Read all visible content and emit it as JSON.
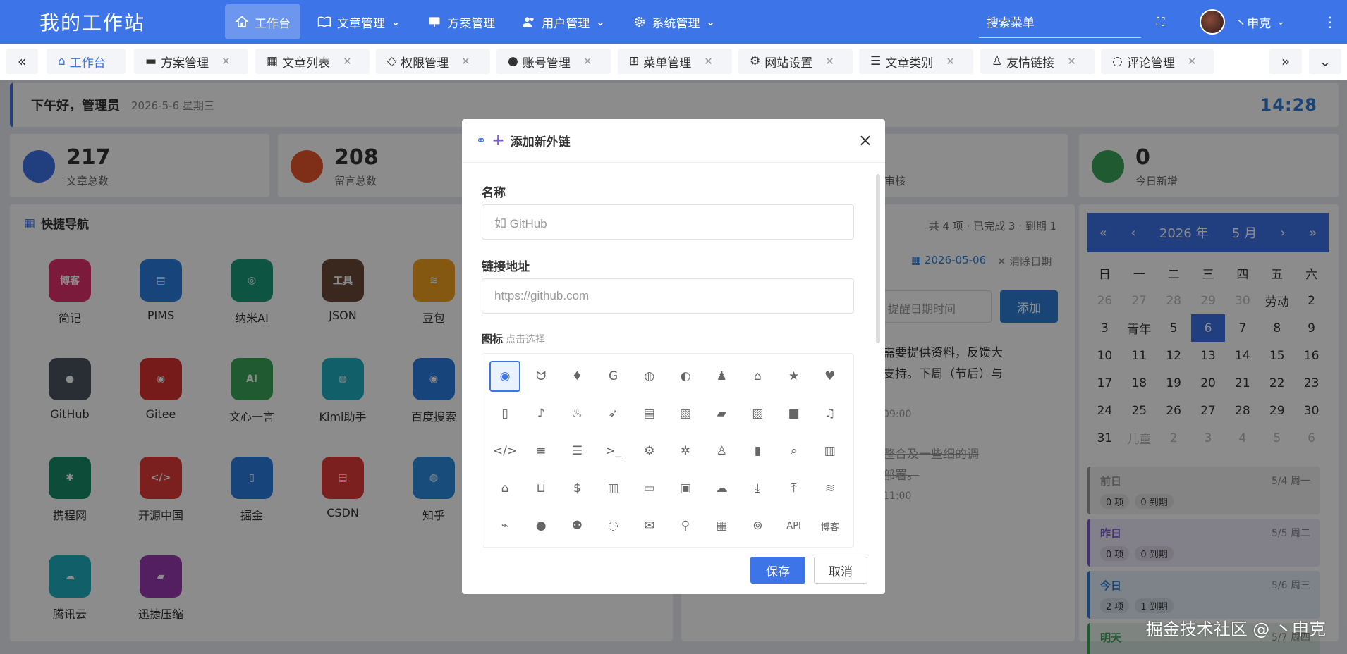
{
  "app": {
    "title": "我的工作站"
  },
  "topnav": {
    "items": [
      {
        "label": "工作台",
        "icon": "home-icon"
      },
      {
        "label": "文章管理",
        "icon": "book-icon"
      },
      {
        "label": "方案管理",
        "icon": "presentation-icon"
      },
      {
        "label": "用户管理",
        "icon": "users-icon"
      },
      {
        "label": "系统管理",
        "icon": "gear-icon"
      }
    ],
    "search_label": "搜索菜单",
    "user": "丶申克"
  },
  "tabs": [
    {
      "label": "工作台"
    },
    {
      "label": "方案管理"
    },
    {
      "label": "文章列表"
    },
    {
      "label": "权限管理"
    },
    {
      "label": "账号管理"
    },
    {
      "label": "菜单管理"
    },
    {
      "label": "网站设置"
    },
    {
      "label": "文章类别"
    },
    {
      "label": "友情链接"
    },
    {
      "label": "评论管理"
    }
  ],
  "greeting": {
    "text": "下午好，管理员",
    "date": "2026-5-6 星期三",
    "time": "14:28"
  },
  "stats": [
    {
      "value": "217",
      "label": "文章总数",
      "color": "#3d74e8"
    },
    {
      "value": "208",
      "label": "留言总数",
      "color": "#e8562a"
    },
    {
      "value": "",
      "label": "审核",
      "color": "#f0a020"
    },
    {
      "value": "0",
      "label": "今日新增",
      "color": "#3aa55a"
    }
  ],
  "quick": {
    "title": "快捷导航",
    "items": [
      {
        "label": "简记",
        "color": "#e0306a",
        "glyph": "博客"
      },
      {
        "label": "PIMS",
        "color": "#2a7fe0",
        "glyph": "▤"
      },
      {
        "label": "纳米AI",
        "color": "#1a9a7a",
        "glyph": "◎"
      },
      {
        "label": "JSON",
        "color": "#6a4a3a",
        "glyph": "工具"
      },
      {
        "label": "豆包",
        "color": "#f0a020",
        "glyph": "≋"
      },
      {
        "label": "GitHub",
        "color": "#4a5560",
        "glyph": "●"
      },
      {
        "label": "Gitee",
        "color": "#d93030",
        "glyph": "◉"
      },
      {
        "label": "文心一言",
        "color": "#3aa55a",
        "glyph": "AI"
      },
      {
        "label": "Kimi助手",
        "color": "#20b0c0",
        "glyph": "◍"
      },
      {
        "label": "百度搜索",
        "color": "#2a7fe0",
        "glyph": "◉"
      },
      {
        "label": "携程网",
        "color": "#1a8a6a",
        "glyph": "✱"
      },
      {
        "label": "开源中国",
        "color": "#e03a3a",
        "glyph": "</>"
      },
      {
        "label": "掘金",
        "color": "#2a7fe0",
        "glyph": "▯"
      },
      {
        "label": "CSDN",
        "color": "#e03a3a",
        "glyph": "▤"
      },
      {
        "label": "知乎",
        "color": "#2a8ae0",
        "glyph": "◍"
      },
      {
        "label": "腾讯云",
        "color": "#20b0c0",
        "glyph": "☁"
      },
      {
        "label": "迅捷压缩",
        "color": "#9a3ab0",
        "glyph": "▰"
      }
    ]
  },
  "todo": {
    "summary": "共 4 项 · 已完成 3 · 到期 1",
    "date": "2026-05-06",
    "clear_label": "清除日期",
    "remind_placeholder": "提醒日期时间",
    "add_label": "添加",
    "text1": "需要提供资料，反馈大",
    "text2": "支持。下周（节后）与",
    "time1": "09:00",
    "text3": "整合及一些细的调",
    "text4": "部署。",
    "time2": "11:00"
  },
  "calendar": {
    "year": "2026 年",
    "month": "5 月",
    "weekdays": [
      "日",
      "一",
      "二",
      "三",
      "四",
      "五",
      "六"
    ],
    "weeks": [
      [
        "26",
        "27",
        "28",
        "29",
        "30",
        "劳动",
        "2"
      ],
      [
        "3",
        "青年",
        "5",
        "6",
        "7",
        "8",
        "9"
      ],
      [
        "10",
        "11",
        "12",
        "13",
        "14",
        "15",
        "16"
      ],
      [
        "17",
        "18",
        "19",
        "20",
        "21",
        "22",
        "23"
      ],
      [
        "24",
        "25",
        "26",
        "27",
        "28",
        "29",
        "30"
      ],
      [
        "31",
        "儿童",
        "2",
        "3",
        "4",
        "5",
        "6"
      ]
    ],
    "selected": "6"
  },
  "days": [
    {
      "name": "前日",
      "date": "5/4 周一",
      "items": "0 项",
      "due": "0 到期",
      "color": "#999999"
    },
    {
      "name": "昨日",
      "date": "5/5 周二",
      "items": "0 项",
      "due": "0 到期",
      "color": "#7a5ad0"
    },
    {
      "name": "今日",
      "date": "5/6 周三",
      "items": "2 项",
      "due": "1 到期",
      "color": "#2d7fd6"
    },
    {
      "name": "明天",
      "date": "5/7 周四",
      "items": "",
      "due": "",
      "color": "#3aa55a"
    }
  ],
  "modal": {
    "title": "添加新外链",
    "name_label": "名称",
    "name_placeholder": "如 GitHub",
    "url_label": "链接地址",
    "url_placeholder": "https://github.com",
    "icon_label": "图标",
    "icon_hint": "点击选择",
    "icons": [
      "globe-icon",
      "cat-icon",
      "gitlab-icon",
      "google-icon",
      "weibo-icon",
      "wechat-icon",
      "qq-icon",
      "home-icon",
      "star-icon",
      "heart-icon",
      "bookmark-icon",
      "bell-icon",
      "fire-icon",
      "rocket-icon",
      "file-icon",
      "code-file-icon",
      "folder-icon",
      "image-icon",
      "video-icon",
      "music-icon",
      "code-icon",
      "database-icon",
      "server-icon",
      "terminal-icon",
      "gear-icon",
      "bug-icon",
      "linux-icon",
      "mobile-icon",
      "search-icon",
      "book-icon",
      "graduation-icon",
      "cart-icon",
      "dollar-icon",
      "chart-icon",
      "card-icon",
      "briefcase-icon",
      "cloud-icon",
      "download-icon",
      "upload-icon",
      "wifi-icon",
      "plug-icon",
      "user-icon",
      "users-icon",
      "chat-icon",
      "mail-icon",
      "pin-icon",
      "calendar-icon",
      "gamepad-icon",
      "API",
      "博客"
    ],
    "save_label": "保存",
    "cancel_label": "取消"
  },
  "watermark": "掘金技术社区 @ 丶申克"
}
